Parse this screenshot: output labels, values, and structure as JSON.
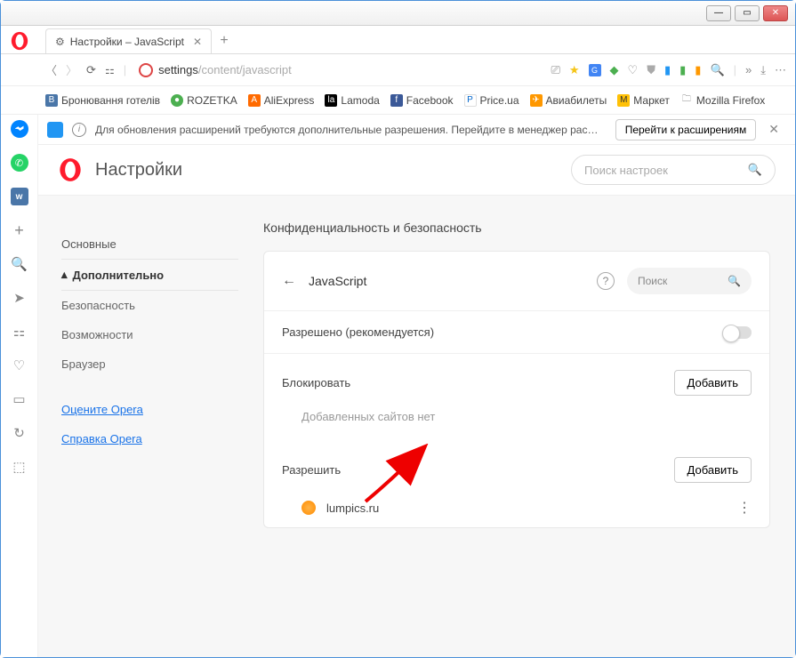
{
  "window": {
    "tab_title": "Настройки – JavaScript"
  },
  "url": {
    "prefix": "settings",
    "path": "/content/javascript"
  },
  "bookmarks": {
    "items": [
      "Бронювання готелів",
      "ROZETKA",
      "AliExpress",
      "Lamoda",
      "Facebook",
      "Price.ua",
      "Авиабилеты",
      "Маркет",
      "Mozilla Firefox"
    ]
  },
  "notif": {
    "text": "Для обновления расширений требуются дополнительные разрешения. Перейдите в менеджер расширений для подт…",
    "button": "Перейти к расширениям"
  },
  "settings": {
    "title": "Настройки",
    "search_placeholder": "Поиск настроек",
    "nav": {
      "basic": "Основные",
      "advanced": "Дополнительно",
      "security": "Безопасность",
      "features": "Возможности",
      "browser": "Браузер",
      "rate": "Оцените Opera",
      "help": "Справка Opera"
    }
  },
  "page": {
    "section": "Конфиденциальность и безопасность",
    "title": "JavaScript",
    "search_placeholder": "Поиск",
    "allowed_recommended": "Разрешено (рекомендуется)",
    "block_heading": "Блокировать",
    "add": "Добавить",
    "empty": "Добавленных сайтов нет",
    "allow_heading": "Разрешить",
    "site": "lumpics.ru"
  }
}
